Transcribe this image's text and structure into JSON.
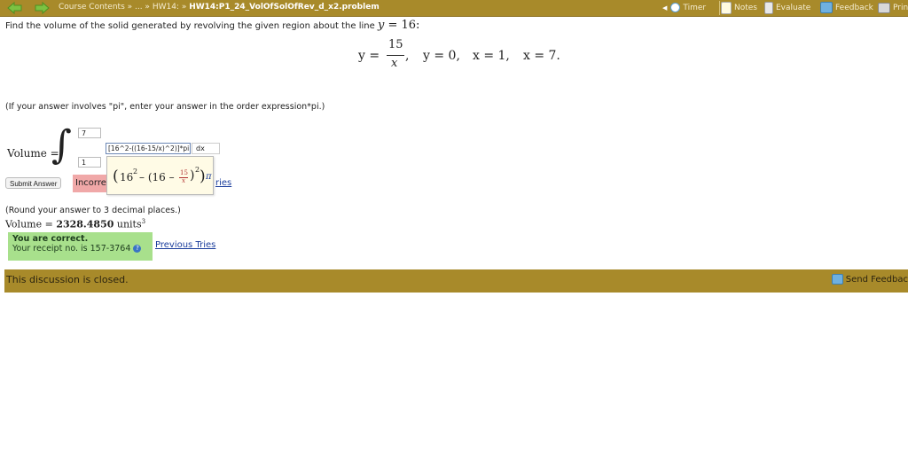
{
  "topbar": {
    "crumbs": {
      "course": "Course Contents",
      "sep1": " » ... » ",
      "hw": "HW14:",
      "sep2": " » ",
      "problem": "HW14:P1_24_VolOfSolOfRev_d_x2.problem"
    },
    "tools": {
      "timer": "Timer",
      "notes": "Notes",
      "evaluate": "Evaluate",
      "feedback": "Feedback",
      "print": "Prin"
    }
  },
  "question": {
    "text": "Find the volume of the solid generated by revolving the given region about the line",
    "axis_var": "y",
    "axis_eq": " = 16:"
  },
  "equations": {
    "y1_lhs": "y =",
    "num": "15",
    "den": "x",
    "comma1": ",",
    "y2": "y = 0,",
    "x1": "x = 1,",
    "x2": "x = 7."
  },
  "hint": "(If your answer involves \"pi\", enter your answer in the order expression*pi.)",
  "integral": {
    "label": "Volume =",
    "upper_limit": "7",
    "lower_limit": "1",
    "integrand_input": "[16^2-((16-15/x)^2)]*pi",
    "dx": "dx",
    "preview": {
      "open": "(",
      "a": "16",
      "exp": "2",
      "minus": " – (16 – ",
      "num": "15",
      "den": "x",
      "close": ")",
      "exp2": "2",
      "close2": ")",
      "pi": "π"
    }
  },
  "submit_label": "Submit Answer",
  "incorrect_label": "Incorre",
  "tries_link": "ries",
  "round_hint": "(Round your answer to 3 decimal places.)",
  "result": {
    "label": "Volume = ",
    "value": "2328.4850",
    "units": " units",
    "units_exp": "3"
  },
  "correct": {
    "title": "You are correct.",
    "receipt": "Your receipt no. is 157-3764"
  },
  "previous_tries": "Previous Tries",
  "discussion": {
    "closed": "This discussion is closed.",
    "send": "Send Feedbac"
  },
  "colors": {
    "bar": "#a88a2a",
    "correct": "#a8e08c",
    "incorrect": "#f0a8a8",
    "link": "#1a3d9c"
  }
}
